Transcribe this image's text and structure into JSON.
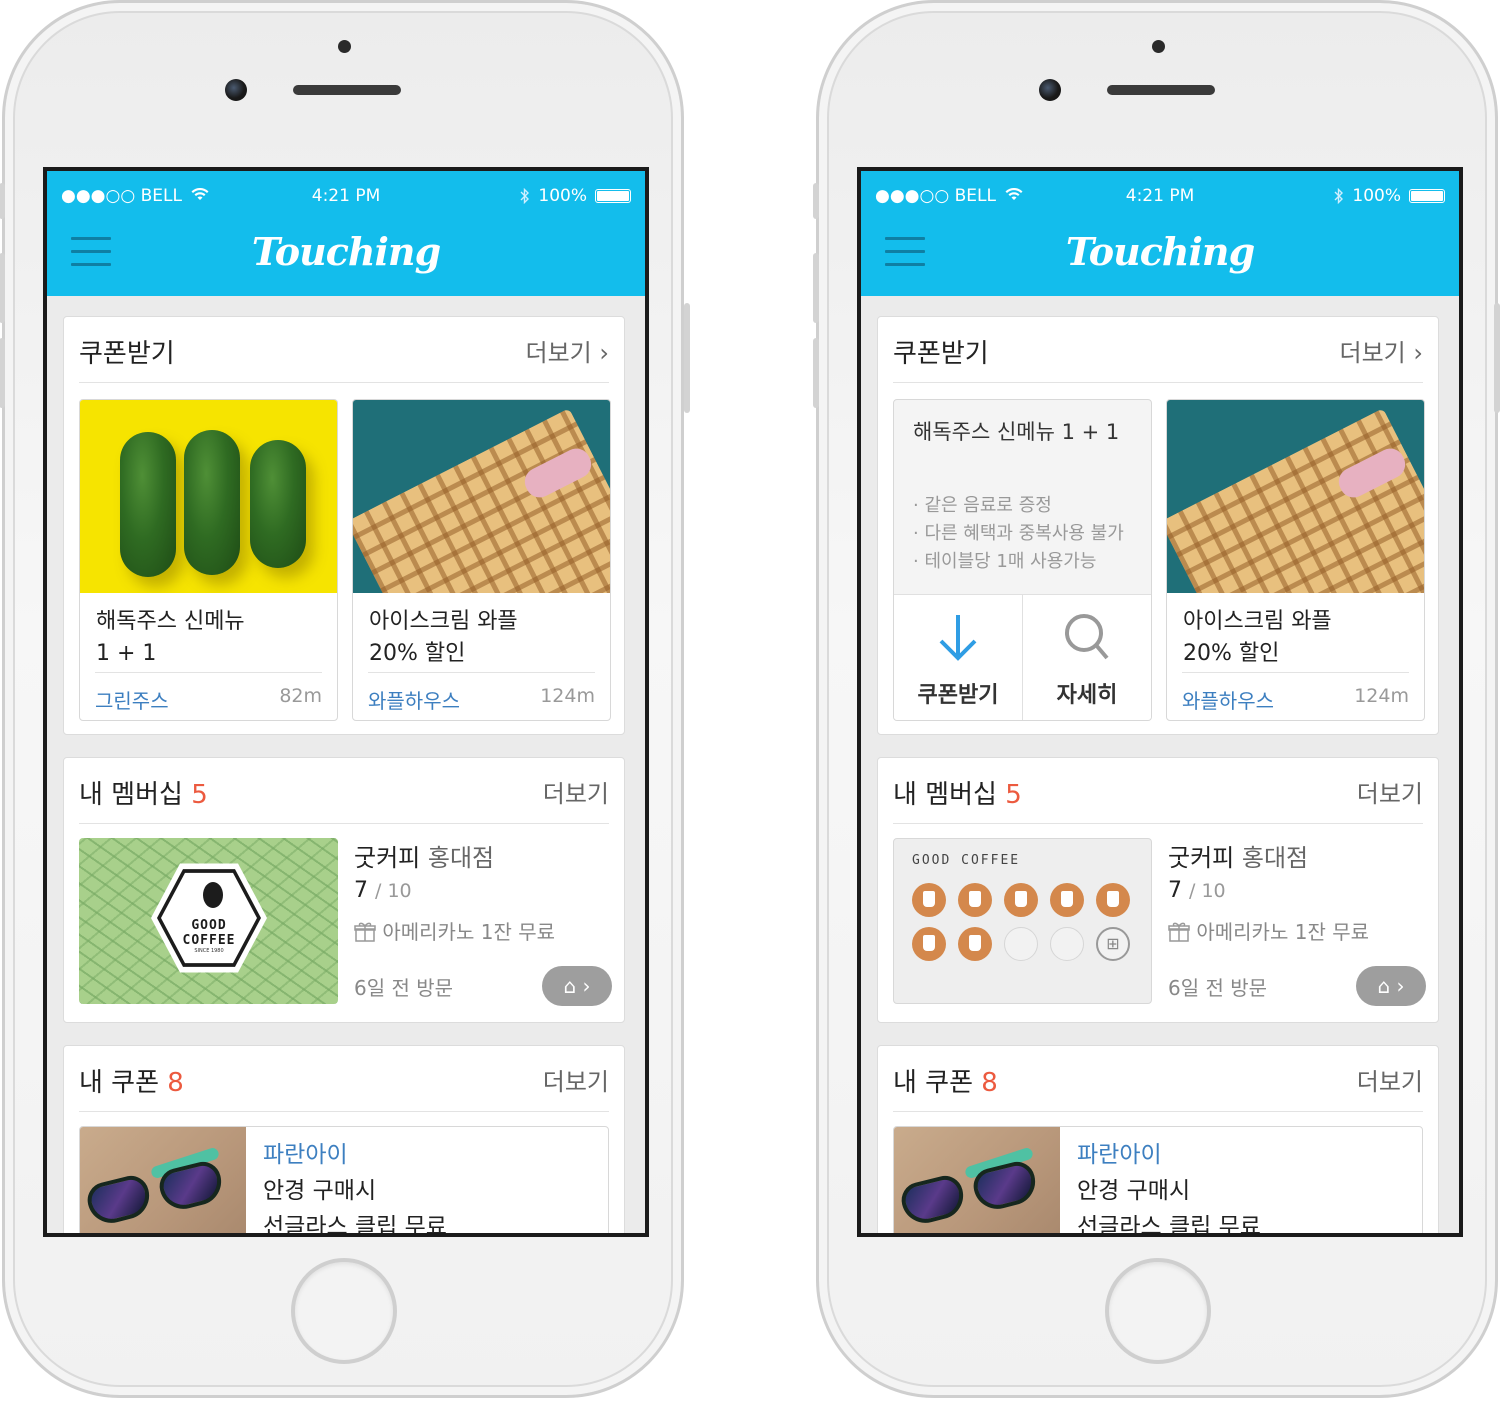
{
  "status": {
    "carrier": "●●●○○ BELL",
    "time": "4:21 PM",
    "battery": "100%"
  },
  "app": {
    "logo": "Touching"
  },
  "coupon_section": {
    "title": "쿠폰받기",
    "more": "더보기"
  },
  "coupons": [
    {
      "title_line1": "해독주스 신메뉴",
      "title_line2": "1 + 1",
      "store": "그린주스",
      "distance": "82m"
    },
    {
      "title_line1": "아이스크림 와플",
      "title_line2": "20% 할인",
      "store": "와플하우스",
      "distance": "124m"
    }
  ],
  "coupon_detail": {
    "title": "해독주스 신메뉴 1 + 1",
    "bullets": [
      "같은 음료로 증정",
      "다른 혜택과 중복사용 불가",
      "테이블당 1매 사용가능"
    ],
    "download_label": "쿠폰받기",
    "detail_label": "자세히"
  },
  "membership_section": {
    "title": "내 멤버십",
    "count": "5",
    "more": "더보기"
  },
  "membership": {
    "store": "굿커피",
    "branch": "홍대점",
    "stamps": "7",
    "total": "/ 10",
    "reward": "아메리카노 1잔 무료",
    "last_visit": "6일 전 방문",
    "card_brand": "GOOD COFFEE",
    "badge_since": "SINCE 1980",
    "store_btn": "⌂ ›"
  },
  "my_coupon_section": {
    "title": "내 쿠폰",
    "count_left": "8",
    "count_right": "8",
    "more": "더보기"
  },
  "my_coupon": {
    "store": "파란아이",
    "line1": "안경 구매시",
    "line2": "선글라스 클립 무료"
  },
  "colors": {
    "brand": "#13bdec",
    "accent": "#ec5a3f",
    "link": "#3d7fc0",
    "stamp": "#d4884c"
  },
  "icons": {
    "menu": "hamburger-icon",
    "wifi": "wifi-icon",
    "bluetooth": "bluetooth-icon",
    "download": "arrow-down-icon",
    "search": "search-icon",
    "gift": "gift-icon",
    "store": "store-icon"
  }
}
